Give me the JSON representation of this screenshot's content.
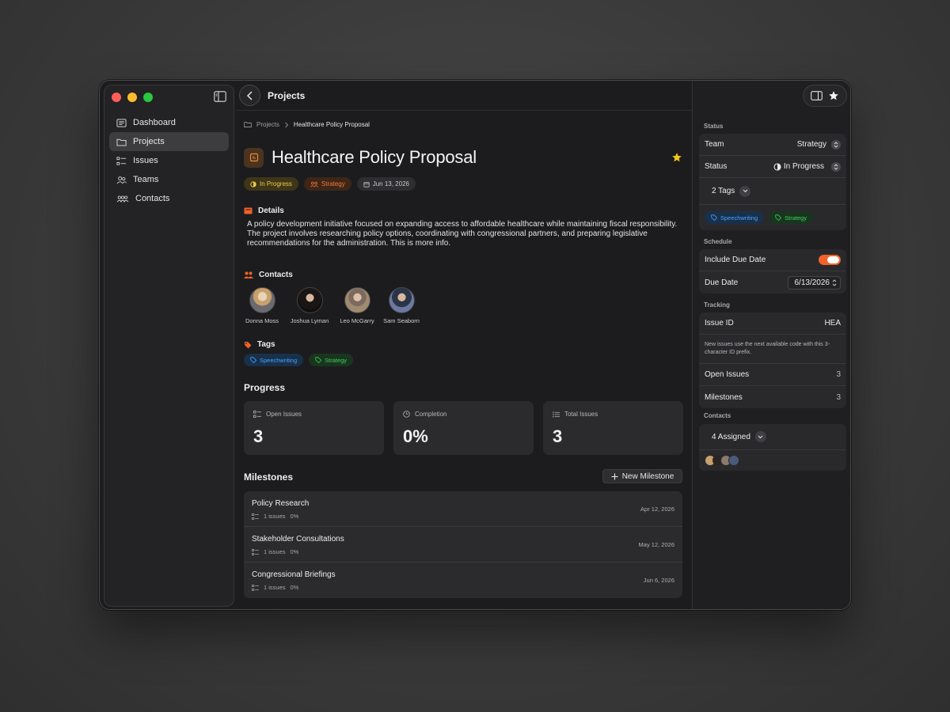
{
  "sidebar": {
    "items": [
      {
        "label": "Dashboard",
        "icon": "dashboard-icon"
      },
      {
        "label": "Projects",
        "icon": "folder-icon",
        "active": true
      },
      {
        "label": "Issues",
        "icon": "list-icon"
      },
      {
        "label": "Teams",
        "icon": "teams-icon"
      },
      {
        "label": "Contacts",
        "icon": "contacts-icon"
      }
    ]
  },
  "header": {
    "title": "Projects"
  },
  "breadcrumb": {
    "root": "Projects",
    "current": "Healthcare Policy Proposal"
  },
  "project": {
    "title": "Healthcare Policy Proposal",
    "starred": true,
    "status": "In Progress",
    "team": "Strategy",
    "date": "Jun 13, 2026"
  },
  "details": {
    "heading": "Details",
    "text": "A policy development initiative focused on expanding access to affordable healthcare while maintaining fiscal responsibility. The project involves researching policy options, coordinating with congressional partners, and preparing legislative recommendations for the administration. This is more info."
  },
  "contacts": {
    "heading": "Contacts",
    "people": [
      {
        "name": "Donna Moss",
        "color": "#b89a78"
      },
      {
        "name": "Joshua Lyman",
        "color": "#2a2422"
      },
      {
        "name": "Leo McGarry",
        "color": "#6d5d52"
      },
      {
        "name": "Sam Seaborn",
        "color": "#4a5a7a"
      }
    ]
  },
  "tags": {
    "heading": "Tags",
    "items": [
      {
        "label": "Speechwriting",
        "color": "#4aa3ff"
      },
      {
        "label": "Strategy",
        "color": "#3fcf5a"
      }
    ]
  },
  "progress": {
    "heading": "Progress",
    "cards": [
      {
        "label": "Open Issues",
        "value": "3",
        "icon": "list-icon"
      },
      {
        "label": "Completion",
        "value": "0%",
        "icon": "clock-icon"
      },
      {
        "label": "Total Issues",
        "value": "3",
        "icon": "bullets-icon"
      }
    ]
  },
  "milestones": {
    "heading": "Milestones",
    "new_label": "New Milestone",
    "items": [
      {
        "name": "Policy Research",
        "issues": "1 issues",
        "pct": "0%",
        "date": "Apr 12, 2026"
      },
      {
        "name": "Stakeholder Consultations",
        "issues": "1 issues",
        "pct": "0%",
        "date": "May 12, 2026"
      },
      {
        "name": "Congressional Briefings",
        "issues": "1 issues",
        "pct": "0%",
        "date": "Jun 6, 2026"
      }
    ]
  },
  "inspector": {
    "status_section": "Status",
    "team_label": "Team",
    "team_value": "Strategy",
    "status_label": "Status",
    "status_value": "In Progress",
    "tags_label": "2 Tags",
    "schedule_section": "Schedule",
    "include_due_label": "Include Due Date",
    "include_due_on": true,
    "due_label": "Due Date",
    "due_value": "6/13/2026",
    "tracking_section": "Tracking",
    "issue_id_label": "Issue ID",
    "issue_id_value": "HEA",
    "issue_note": "New issues use the next available code with this 3-character ID prefix.",
    "open_issues_label": "Open Issues",
    "open_issues_value": "3",
    "milestones_label": "Milestones",
    "milestones_value": "3",
    "contacts_section": "Contacts",
    "assigned_label": "4 Assigned"
  },
  "colors": {
    "accent": "#f2622a",
    "star": "#f5c518",
    "in_progress": "#f2c94c"
  }
}
